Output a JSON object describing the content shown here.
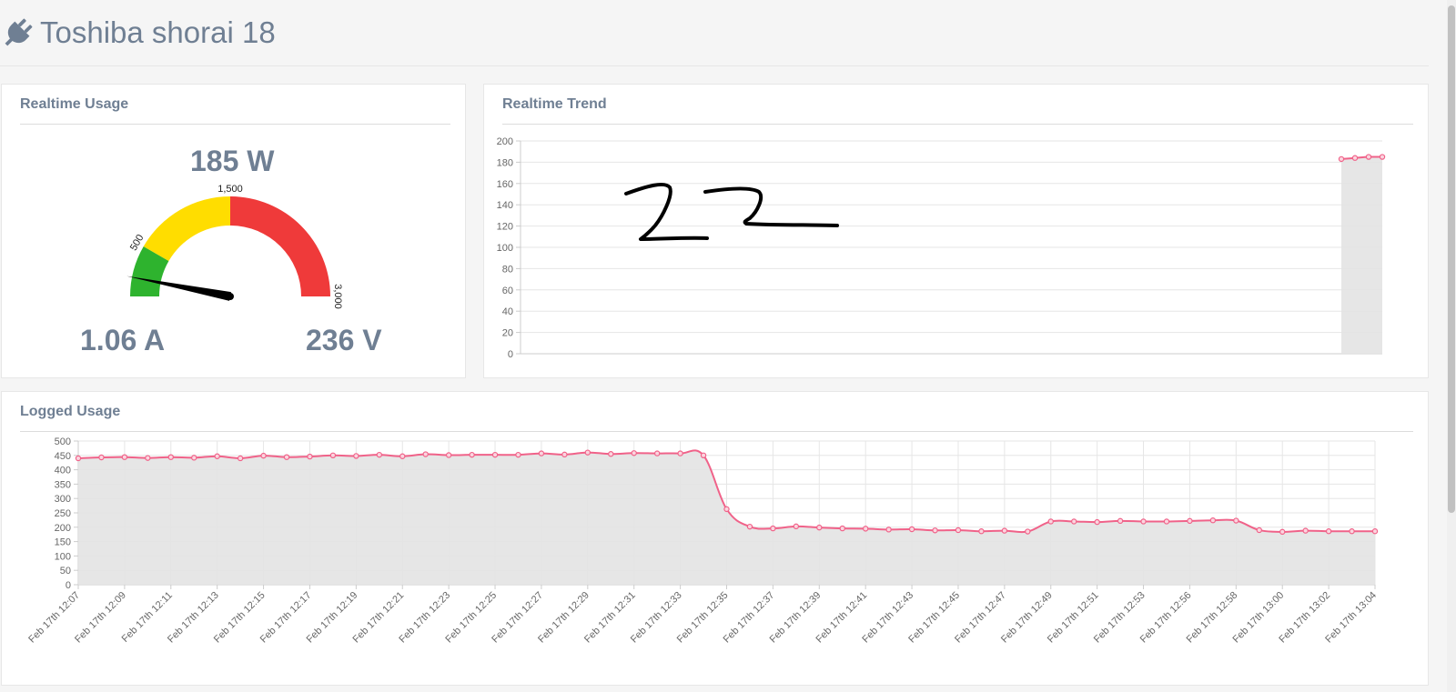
{
  "header": {
    "title": "Toshiba shorai 18",
    "icon": "plug-icon"
  },
  "realtime_usage": {
    "title": "Realtime Usage",
    "watts": "185 W",
    "amps": "1.06 A",
    "volts": "236 V",
    "gauge": {
      "min": 0,
      "max": 3000,
      "value": 185,
      "labels": [
        "500",
        "1,500",
        "3,000"
      ],
      "bands": [
        {
          "from": 0,
          "to": 500,
          "color": "#2eb32e"
        },
        {
          "from": 500,
          "to": 1500,
          "color": "#ffdd00"
        },
        {
          "from": 1500,
          "to": 3000,
          "color": "#ef3a3a"
        }
      ]
    }
  },
  "realtime_trend": {
    "title": "Realtime Trend",
    "annotation": "22"
  },
  "logged_usage": {
    "title": "Logged Usage"
  },
  "colors": {
    "line": "#f06289",
    "area": "#e3e3e3",
    "text": "#6f7f93"
  },
  "chart_data": [
    {
      "type": "area",
      "title": "Realtime Trend",
      "ylim": [
        0,
        200
      ],
      "yticks": [
        "0",
        "20",
        "40",
        "60",
        "80",
        "100",
        "120",
        "140",
        "160",
        "180",
        "200"
      ],
      "series": [
        {
          "values": [
            183,
            184,
            185,
            185
          ]
        }
      ],
      "grid": true
    },
    {
      "type": "area",
      "title": "Logged Usage",
      "ylim": [
        0,
        500
      ],
      "yticks": [
        "0",
        "50",
        "100",
        "150",
        "200",
        "250",
        "300",
        "350",
        "400",
        "450",
        "500"
      ],
      "xticks": [
        "Feb 17th 12:07",
        "Feb 17th 12:09",
        "Feb 17th 12:11",
        "Feb 17th 12:13",
        "Feb 17th 12:15",
        "Feb 17th 12:17",
        "Feb 17th 12:19",
        "Feb 17th 12:21",
        "Feb 17th 12:23",
        "Feb 17th 12:25",
        "Feb 17th 12:27",
        "Feb 17th 12:29",
        "Feb 17th 12:31",
        "Feb 17th 12:33",
        "Feb 17th 12:35",
        "Feb 17th 12:37",
        "Feb 17th 12:39",
        "Feb 17th 12:41",
        "Feb 17th 12:43",
        "Feb 17th 12:45",
        "Feb 17th 12:47",
        "Feb 17th 12:49",
        "Feb 17th 12:51",
        "Feb 17th 12:53",
        "Feb 17th 12:56",
        "Feb 17th 12:58",
        "Feb 17th 13:00",
        "Feb 17th 13:02",
        "Feb 17th 13:04"
      ],
      "series": [
        {
          "values": [
            440,
            443,
            444,
            441,
            444,
            442,
            447,
            440,
            449,
            444,
            446,
            450,
            448,
            452,
            447,
            454,
            451,
            452,
            452,
            452,
            457,
            453,
            460,
            455,
            458,
            457,
            457,
            450,
            263,
            202,
            196,
            203,
            199,
            196,
            195,
            192,
            193,
            189,
            190,
            186,
            188,
            185,
            220,
            220,
            218,
            222,
            220,
            220,
            222,
            224,
            223,
            190,
            184,
            188,
            186,
            186,
            186
          ]
        }
      ],
      "grid": true
    }
  ]
}
